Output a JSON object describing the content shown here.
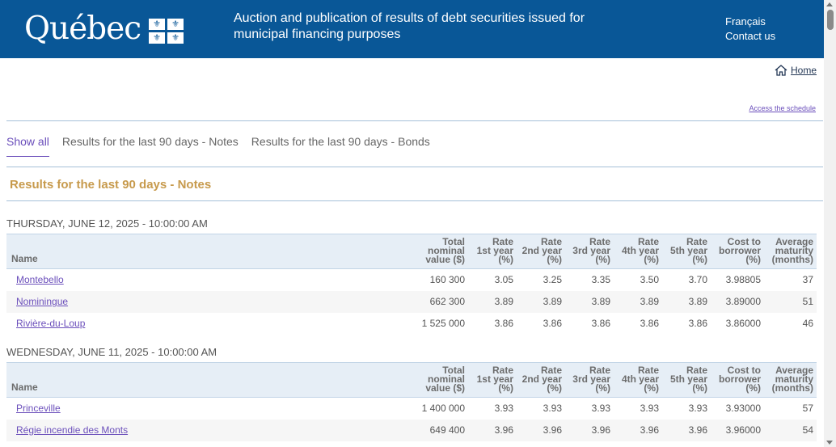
{
  "header": {
    "logo_text": "Québec",
    "fleur": "⚜",
    "title": "Auction and publication of results of debt securities issued for municipal financing purposes",
    "lang_link": "Français",
    "contact_link": "Contact us"
  },
  "nav": {
    "home_label": "Home",
    "schedule_link": "Access the schedule"
  },
  "tabs": [
    {
      "label": "Show all",
      "active": true
    },
    {
      "label": "Results for the last 90 days - Notes",
      "active": false
    },
    {
      "label": "Results for the last 90 days - Bonds",
      "active": false
    }
  ],
  "section_title": "Results for the last 90 days - Notes",
  "table_headers": {
    "name": "Name",
    "total_1": "Total",
    "total_2": "nominal",
    "total_3": "value ($)",
    "r1_1": "Rate",
    "r1_2": "1st year",
    "r1_3": "(%)",
    "r2_1": "Rate",
    "r2_2": "2nd year",
    "r2_3": "(%)",
    "r3_1": "Rate",
    "r3_2": "3rd year",
    "r3_3": "(%)",
    "r4_1": "Rate",
    "r4_2": "4th year",
    "r4_3": "(%)",
    "r5_1": "Rate",
    "r5_2": "5th year",
    "r5_3": "(%)",
    "cost_1": "Cost to",
    "cost_2": "borrower",
    "cost_3": "(%)",
    "avg_1": "Average",
    "avg_2": "maturity",
    "avg_3": "(months)"
  },
  "days": [
    {
      "date": "THURSDAY, JUNE 12, 2025 - 10:00:00 AM",
      "rows": [
        {
          "name": "Montebello",
          "total": "160 300",
          "r1": "3.05",
          "r2": "3.25",
          "r3": "3.35",
          "r4": "3.50",
          "r5": "3.70",
          "cost": "3.98805",
          "avg": "37"
        },
        {
          "name": "Nominingue",
          "total": "662 300",
          "r1": "3.89",
          "r2": "3.89",
          "r3": "3.89",
          "r4": "3.89",
          "r5": "3.89",
          "cost": "3.89000",
          "avg": "51"
        },
        {
          "name": "Rivière-du-Loup",
          "total": "1 525 000",
          "r1": "3.86",
          "r2": "3.86",
          "r3": "3.86",
          "r4": "3.86",
          "r5": "3.86",
          "cost": "3.86000",
          "avg": "46"
        }
      ]
    },
    {
      "date": "WEDNESDAY, JUNE 11, 2025 - 10:00:00 AM",
      "rows": [
        {
          "name": "Princeville",
          "total": "1 400 000",
          "r1": "3.93",
          "r2": "3.93",
          "r3": "3.93",
          "r4": "3.93",
          "r5": "3.93",
          "cost": "3.93000",
          "avg": "57"
        },
        {
          "name": "Régie incendie des Monts",
          "total": "649 400",
          "r1": "3.96",
          "r2": "3.96",
          "r3": "3.96",
          "r4": "3.96",
          "r5": "3.96",
          "cost": "3.96000",
          "avg": "54"
        }
      ]
    }
  ],
  "colors": {
    "brand_blue": "#095797",
    "link_purple": "#6b4fbb",
    "section_gold": "#c79a4c"
  }
}
